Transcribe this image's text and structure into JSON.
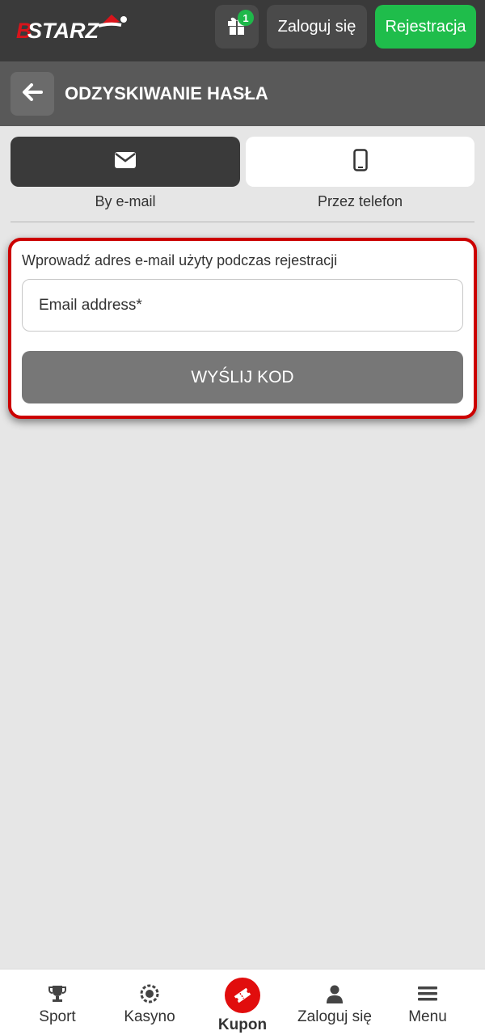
{
  "header": {
    "logo_text": "BETSTARZ",
    "gift_badge_count": "1",
    "login_label": "Zaloguj się",
    "register_label": "Rejestracja"
  },
  "page": {
    "title": "ODZYSKIWANIE HASŁA"
  },
  "tabs": [
    {
      "label": "By e-mail",
      "icon": "envelope-icon",
      "active": true
    },
    {
      "label": "Przez telefon",
      "icon": "phone-icon",
      "active": false
    }
  ],
  "form": {
    "instruction": "Wprowadź adres e-mail użyty podczas rejestracji",
    "email_placeholder": "Email address*",
    "submit_label": "WYŚLIJ KOD"
  },
  "bottom_nav": [
    {
      "label": "Sport",
      "icon": "trophy-icon"
    },
    {
      "label": "Kasyno",
      "icon": "casino-chip-icon"
    },
    {
      "label": "Kupon",
      "icon": "ticket-icon"
    },
    {
      "label": "Zaloguj się",
      "icon": "user-icon"
    },
    {
      "label": "Menu",
      "icon": "hamburger-icon"
    }
  ],
  "colors": {
    "accent_green": "#1fbd4b",
    "accent_red": "#cc0000",
    "header_bg": "#3a3a3a"
  }
}
